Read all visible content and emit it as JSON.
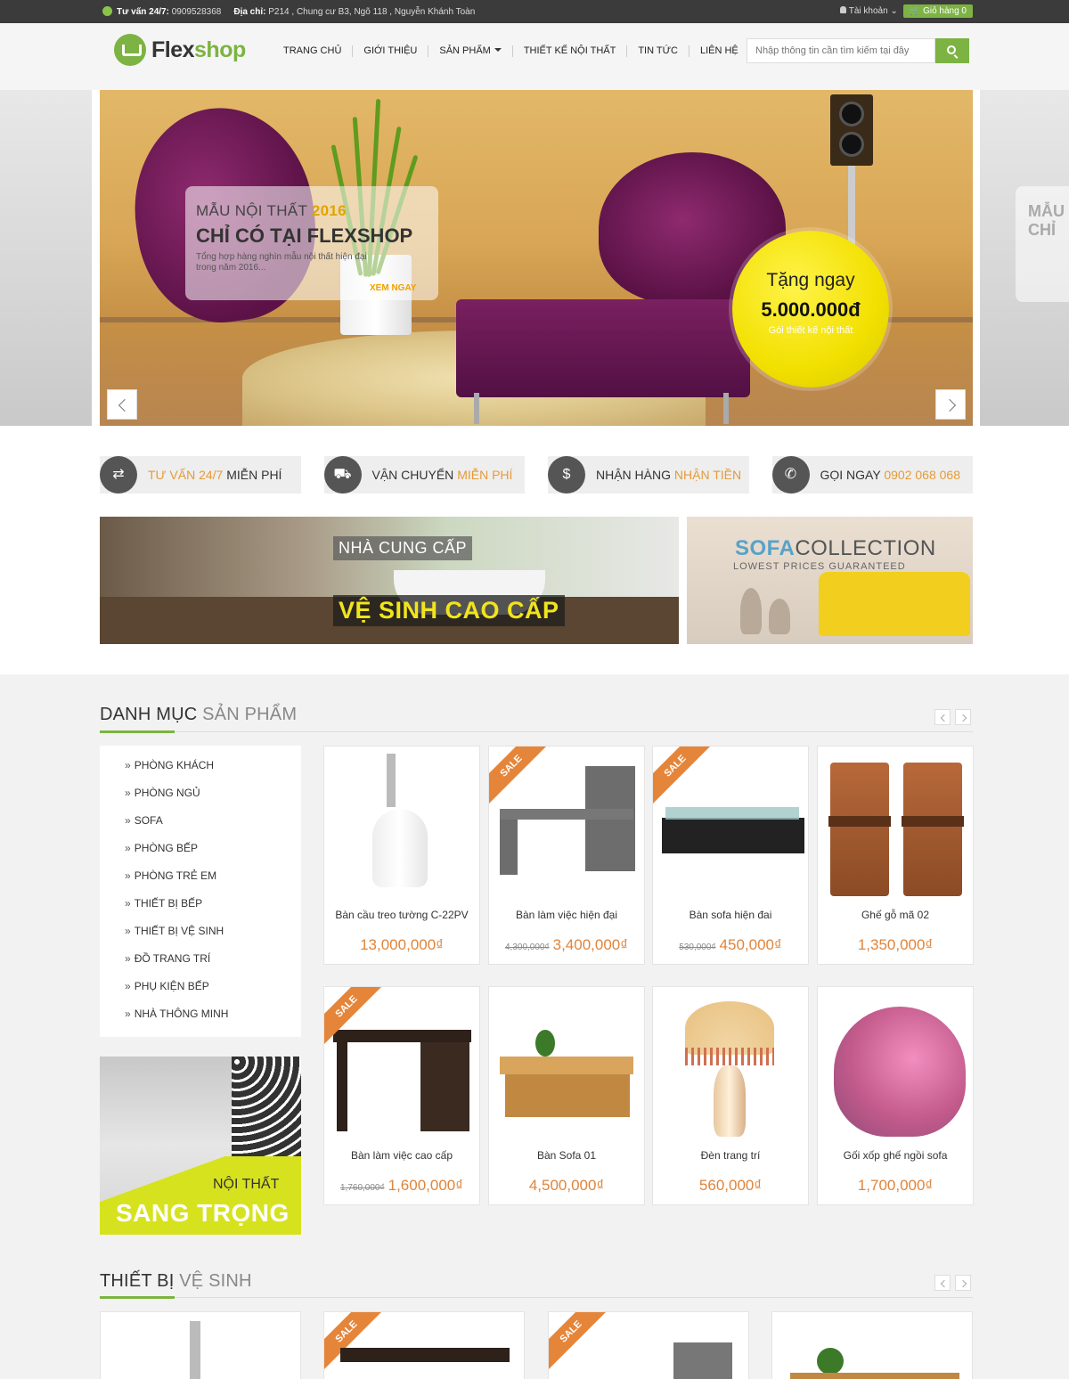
{
  "topbar": {
    "hotline_label": "Tư vấn 24/7:",
    "hotline_number": "0909528368",
    "address_label": "Địa chỉ:",
    "address_value": "P214 , Chung cư B3, Ngõ 118 , Nguyễn Khánh Toàn",
    "account_label": "Tài khoản",
    "cart_label": "Giỏ hàng 0"
  },
  "header": {
    "logo_part1": "Flex",
    "logo_part2": "shop",
    "nav": [
      "TRANG CHỦ",
      "GIỚI THIỆU",
      "SẢN PHẨM",
      "THIẾT KẾ NỘI THẤT",
      "TIN TỨC",
      "LIÊN HỆ"
    ],
    "search_placeholder": "Nhập thông tin cần tìm kiếm tại đây"
  },
  "slider": {
    "line1": "MẪU NỘI THẤT",
    "line1_year": "2016",
    "line2": "CHỈ CÓ TẠI FLEXSHOP",
    "line3": "Tổng hợp hàng nghìn mẫu nội thất hiện đại trong năm 2016...",
    "cta": "XEM NGAY",
    "gift_line1": "Tặng ngay",
    "gift_amount": "5.000.000đ",
    "gift_line3": "Gói thiết kế nội thất",
    "side_ghost": "MẪU I CHỈ"
  },
  "services": [
    {
      "icon": "swap-icon",
      "text1": "TƯ VẤN 24/7",
      "text2": "MIỄN PHÍ",
      "text1_highlight": true
    },
    {
      "icon": "truck-icon",
      "text1": "VẬN CHUYỂN",
      "text2": "MIỄN PHÍ",
      "text1_highlight": false
    },
    {
      "icon": "money-bag-icon",
      "text1": "NHẬN HÀNG",
      "text2": "NHẬN TIỀN",
      "text1_highlight": false
    },
    {
      "icon": "phone-icon",
      "text1": "GỌI NGAY",
      "text2": "0902 068 068",
      "text1_highlight": false
    }
  ],
  "banners": {
    "b1_line1": "NHÀ CUNG CẤP",
    "b1_line2": "VỆ SINH CAO CẤP",
    "b2_title1": "SOFA",
    "b2_title2": "COLLECTION",
    "b2_sub": "LOWEST PRICES GUARANTEED"
  },
  "catalog": {
    "title1": "DANH MỤC",
    "title2": "SẢN PHẨM",
    "categories": [
      "PHÒNG KHÁCH",
      "PHÒNG NGỦ",
      "SOFA",
      "PHÒNG BẾP",
      "PHÒNG TRẺ EM",
      "THIẾT BỊ BẾP",
      "THIẾT BỊ VỆ SINH",
      "ĐỒ TRANG TRÍ",
      "PHỤ KIỆN BẾP",
      "NHÀ THÔNG MINH"
    ],
    "side_banner_line1": "NỘI THẤT",
    "side_banner_line2": "SANG TRỌNG",
    "sale_label": "SALE",
    "products": [
      {
        "name": "Bàn cầu treo tường C-22PV",
        "old": "",
        "price": "13,000,000₫",
        "sale": false
      },
      {
        "name": "Bàn làm việc hiện đại",
        "old": "4,300,000₫",
        "price": "3,400,000₫",
        "sale": true
      },
      {
        "name": "Bàn sofa hiện đai",
        "old": "530,000₫",
        "price": "450,000₫",
        "sale": true
      },
      {
        "name": "Ghế gỗ mã 02",
        "old": "",
        "price": "1,350,000₫",
        "sale": false
      },
      {
        "name": "Bàn làm việc cao cấp",
        "old": "1,760,000₫",
        "price": "1,600,000₫",
        "sale": true
      },
      {
        "name": "Bàn Sofa 01",
        "old": "",
        "price": "4,500,000₫",
        "sale": false
      },
      {
        "name": "Đèn trang trí",
        "old": "",
        "price": "560,000₫",
        "sale": false
      },
      {
        "name": "Gối xốp ghế ngồi sofa",
        "old": "",
        "price": "1,700,000₫",
        "sale": false
      }
    ]
  },
  "section2": {
    "title1": "THIẾT BỊ",
    "title2": "VỆ SINH"
  },
  "colors": {
    "accent": "#7cb342",
    "price": "#e0843a",
    "highlight": "#e59b36"
  }
}
